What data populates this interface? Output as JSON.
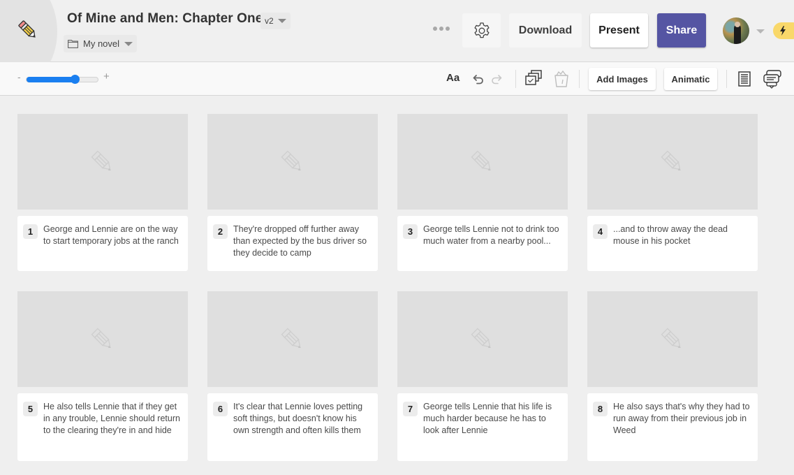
{
  "header": {
    "title": "Of Mine and Men: Chapter One",
    "version": "v2",
    "folder": "My novel",
    "buttons": {
      "download": "Download",
      "present": "Present",
      "share": "Share"
    },
    "colors": {
      "share_bg": "#5555a3",
      "badge_bg": "#f9d86a",
      "accent": "#1a7ff0"
    }
  },
  "toolbar": {
    "zoom_minus": "-",
    "zoom_plus": "+",
    "zoom_level_fraction": 0.68,
    "text_style": "Aa",
    "add_images": "Add Images",
    "animatic": "Animatic"
  },
  "frames": [
    {
      "number": "1",
      "text": "George and Lennie are on the way to start temporary jobs at the ranch"
    },
    {
      "number": "2",
      "text": "They're dropped off further away than expected by the bus driver so they decide to camp"
    },
    {
      "number": "3",
      "text": "George tells Lennie not to drink too much water from a nearby pool..."
    },
    {
      "number": "4",
      "text": "...and to throw away the dead mouse in his pocket"
    },
    {
      "number": "5",
      "text": "He also tells Lennie that if they get in any trouble, Lennie should return to the clearing they're in and hide"
    },
    {
      "number": "6",
      "text": "It's clear that Lennie loves petting soft things, but doesn't know his own strength and often kills them"
    },
    {
      "number": "7",
      "text": "George tells Lennie that his life is much harder because he has to look after Lennie"
    },
    {
      "number": "8",
      "text": "He also says that's why they had to run away from their previous job in Weed"
    }
  ]
}
